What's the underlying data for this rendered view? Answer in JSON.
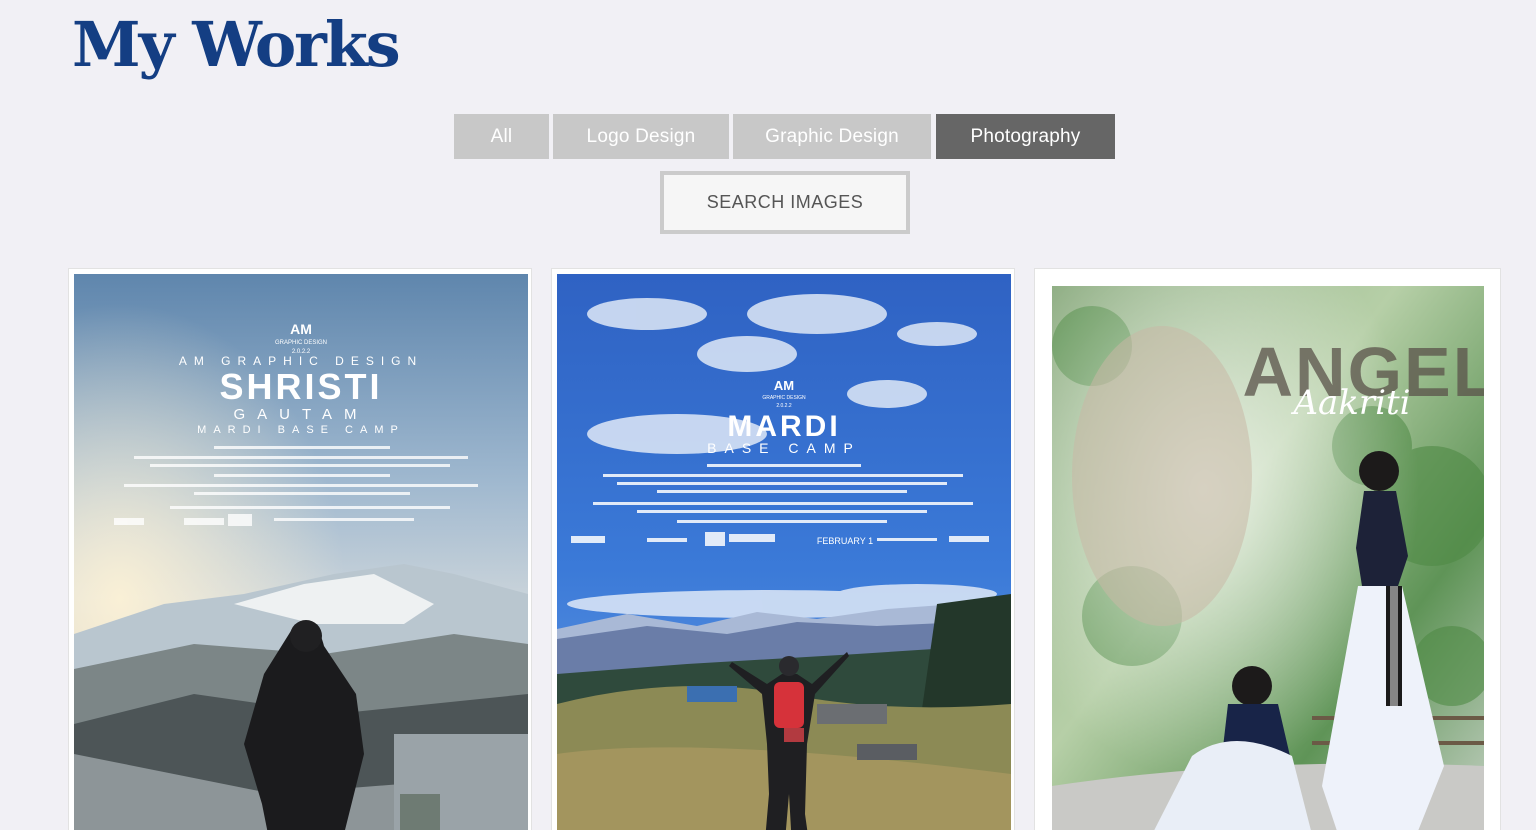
{
  "page": {
    "title": "My Works"
  },
  "filters": [
    {
      "label": "All",
      "active": false
    },
    {
      "label": "Logo Design",
      "active": false
    },
    {
      "label": "Graphic Design",
      "active": false
    },
    {
      "label": "Photography",
      "active": true
    }
  ],
  "search": {
    "placeholder": "SEARCH IMAGES"
  },
  "works": [
    {
      "brand": "AM",
      "brand_sub": "GRAPHIC DESIGN",
      "year": "2.0.2.2",
      "studio": "AM GRAPHIC DESIGN",
      "headline": "SHRISTI",
      "subline": "GAUTAM",
      "tagline": "MARDI BASE CAMP"
    },
    {
      "brand": "AM",
      "brand_sub": "GRAPHIC DESIGN",
      "year": "2.0.2.2",
      "headline": "MARDI",
      "subline": "BASE CAMP",
      "release": "FEBRUARY 1"
    },
    {
      "headline": "ANGEL",
      "script": "Aakriti"
    }
  ],
  "colors": {
    "title": "#143e83",
    "filter_inactive": "#c8c8c8",
    "filter_active": "#666666",
    "background": "#f1f0f5"
  }
}
